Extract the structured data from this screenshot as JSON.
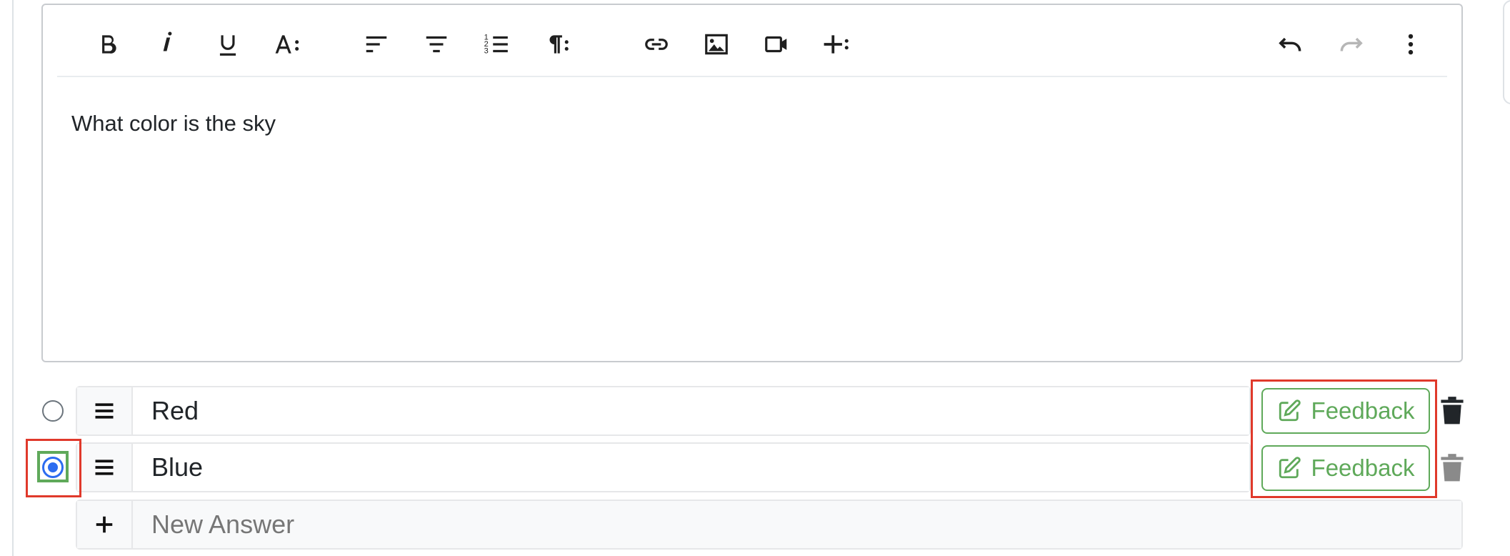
{
  "editor": {
    "content": "What color is the sky",
    "toolbar": [
      "bold",
      "italic",
      "underline",
      "font-size",
      "align-left",
      "align-center",
      "ordered-list",
      "paragraph",
      "link",
      "image",
      "video",
      "insert",
      "undo",
      "redo",
      "more"
    ]
  },
  "answers": [
    {
      "text": "Red",
      "selected": false,
      "feedback_label": "Feedback"
    },
    {
      "text": "Blue",
      "selected": true,
      "feedback_label": "Feedback"
    }
  ],
  "new_answer": {
    "placeholder": "New Answer"
  },
  "colors": {
    "accent_green": "#5fa95a",
    "highlight_red": "#e0392b",
    "radio_blue": "#2c6cf0"
  }
}
